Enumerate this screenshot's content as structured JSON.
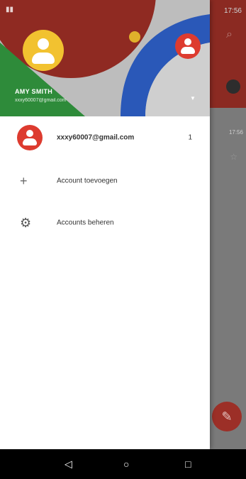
{
  "status_bar": {
    "time": "17:56"
  },
  "drawer": {
    "profile": {
      "name": "AMY SMITH",
      "email": "xxxy60007@gmail.com"
    },
    "accounts": [
      {
        "email": "xxxy60007@gmail.com",
        "count": "1"
      }
    ],
    "actions": [
      {
        "label": "Account toevoegen",
        "icon": "plus-icon"
      },
      {
        "label": "Accounts beheren",
        "icon": "gear-icon"
      }
    ]
  },
  "background": {
    "list_time": "17:56"
  },
  "colors": {
    "avatar_yellow": "#f2c230",
    "avatar_red": "#dd3b2f",
    "appbar_red": "#8b2a22",
    "header_green": "#2e8b3a",
    "header_blue": "#2a58b8"
  }
}
